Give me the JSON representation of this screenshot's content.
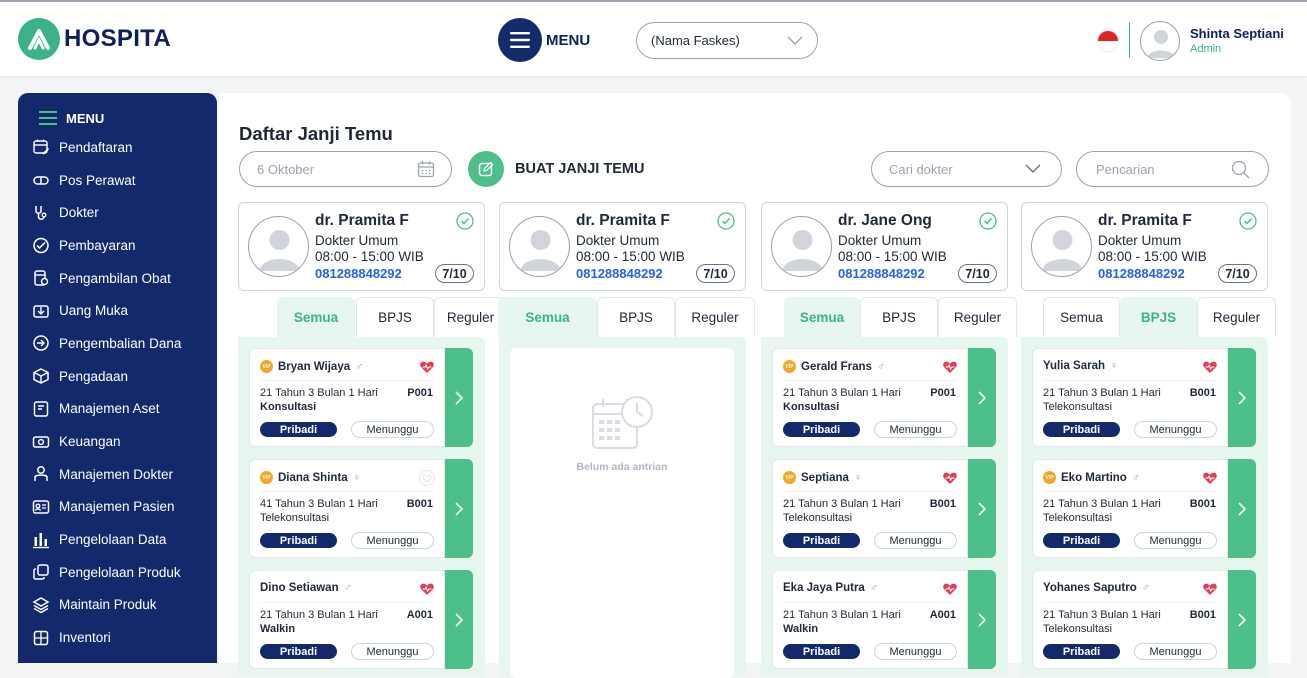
{
  "header": {
    "brand": "HOSPITA",
    "menu_label": "MENU",
    "faskes_value": "(Nama Faskes)",
    "user_name": "Shinta Septiani",
    "user_role": "Admin"
  },
  "sidebar": {
    "title": "MENU",
    "items": [
      {
        "label": "Pendaftaran",
        "icon": "calendar-edit-icon"
      },
      {
        "label": "Pos Perawat",
        "icon": "capsule-icon"
      },
      {
        "label": "Dokter",
        "icon": "stethoscope-icon"
      },
      {
        "label": "Pembayaran",
        "icon": "payment-icon"
      },
      {
        "label": "Pengambilan Obat",
        "icon": "medicine-icon"
      },
      {
        "label": "Uang Muka",
        "icon": "wallet-icon"
      },
      {
        "label": "Pengembalian Dana",
        "icon": "refund-icon"
      },
      {
        "label": "Pengadaan",
        "icon": "box-icon"
      },
      {
        "label": "Manajemen Aset",
        "icon": "asset-icon"
      },
      {
        "label": "Keuangan",
        "icon": "money-icon"
      },
      {
        "label": "Manajemen Dokter",
        "icon": "doctor-icon"
      },
      {
        "label": "Manajemen Pasien",
        "icon": "patient-card-icon"
      },
      {
        "label": "Pengelolaan Data",
        "icon": "bar-chart-icon"
      },
      {
        "label": "Pengelolaan Produk",
        "icon": "products-icon"
      },
      {
        "label": "Maintain Produk",
        "icon": "layers-icon"
      },
      {
        "label": "Inventori",
        "icon": "inventory-icon"
      }
    ]
  },
  "main": {
    "title": "Daftar Janji Temu",
    "date_placeholder": "6 Oktober",
    "create_label": "BUAT  JANJI TEMU",
    "doctor_filter_placeholder": "Cari dokter",
    "search_placeholder": "Pencarian",
    "empty_text": "Belum ada antrian"
  },
  "colors": {
    "navy": "#13296b",
    "green": "#4cbf8a",
    "mint": "#e8f6f0",
    "blue": "#2563eb"
  },
  "columns": [
    {
      "doctor": {
        "name": "dr. Pramita F",
        "specialty": "Dokter Umum",
        "hours": "08:00 - 15:00 WIB",
        "phone": "081288848292",
        "quota": "7/10"
      },
      "tabs": [
        "Semua",
        "BPJS",
        "Reguler"
      ],
      "active_tab": 0,
      "patients": [
        {
          "name": "Bryan Wijaya",
          "vip": true,
          "gender": "♂",
          "heart": "filled",
          "age": "21 Tahun 3 Bulan 1 Hari",
          "code": "P001",
          "type": "Konsultasi",
          "type_bold": true,
          "payment": "Pribadi",
          "status": "Menunggu"
        },
        {
          "name": "Diana Shinta",
          "vip": true,
          "gender": "♀",
          "heart": "outline",
          "age": "41 Tahun 3 Bulan 1 Hari",
          "code": "B001",
          "type": "Telekonsultasi",
          "type_bold": false,
          "payment": "Pribadi",
          "status": "Menunggu"
        },
        {
          "name": "Dino Setiawan",
          "vip": false,
          "gender": "♂",
          "heart": "filled",
          "age": "21 Tahun 3 Bulan 1 Hari",
          "code": "A001",
          "type": "Walkin",
          "type_bold": true,
          "payment": "Pribadi",
          "status": "Menunggu"
        }
      ]
    },
    {
      "doctor": {
        "name": "dr. Pramita F",
        "specialty": "Dokter Umum",
        "hours": "08:00 - 15:00 WIB",
        "phone": "081288848292",
        "quota": "7/10"
      },
      "tabs": [
        "Semua",
        "BPJS",
        "Reguler"
      ],
      "active_tab": 0,
      "patients": []
    },
    {
      "doctor": {
        "name": "dr. Jane Ong",
        "specialty": "Dokter Umum",
        "hours": "08:00 - 15:00 WIB",
        "phone": "081288848292",
        "quota": "7/10"
      },
      "tabs": [
        "Semua",
        "BPJS",
        "Reguler"
      ],
      "active_tab": 0,
      "patients": [
        {
          "name": "Gerald Frans",
          "vip": true,
          "gender": "♂",
          "heart": "filled",
          "age": "21 Tahun 3 Bulan 1 Hari",
          "code": "P001",
          "type": "Konsultasi",
          "type_bold": true,
          "payment": "Pribadi",
          "status": "Menunggu"
        },
        {
          "name": "Septiana",
          "vip": true,
          "gender": "♀",
          "heart": "filled",
          "age": "21 Tahun 3 Bulan 1 Hari",
          "code": "B001",
          "type": "Telekonsultasi",
          "type_bold": false,
          "payment": "Pribadi",
          "status": "Menunggu"
        },
        {
          "name": "Eka Jaya Putra",
          "vip": false,
          "gender": "♂",
          "heart": "filled",
          "age": "21 Tahun 3 Bulan 1 Hari",
          "code": "A001",
          "type": "Walkin",
          "type_bold": true,
          "payment": "Pribadi",
          "status": "Menunggu"
        }
      ]
    },
    {
      "doctor": {
        "name": "dr. Pramita F",
        "specialty": "Dokter Umum",
        "hours": "08:00 - 15:00 WIB",
        "phone": "081288848292",
        "quota": "7/10"
      },
      "tabs": [
        "Semua",
        "BPJS",
        "Reguler"
      ],
      "active_tab": 1,
      "patients": [
        {
          "name": "Yulia Sarah",
          "vip": false,
          "gender": "♀",
          "heart": "filled",
          "age": "21 Tahun 3 Bulan 1 Hari",
          "code": "B001",
          "type": "Telekonsultasi",
          "type_bold": false,
          "payment": "Pribadi",
          "status": "Menunggu"
        },
        {
          "name": "Eko Martino",
          "vip": true,
          "gender": "♂",
          "heart": "filled",
          "age": "21 Tahun 3 Bulan 1 Hari",
          "code": "B001",
          "type": "Telekonsultasi",
          "type_bold": false,
          "payment": "Pribadi",
          "status": "Menunggu"
        },
        {
          "name": "Yohanes Saputro",
          "vip": false,
          "gender": "♂",
          "heart": "filled",
          "age": "21 Tahun 3 Bulan 1 Hari",
          "code": "B001",
          "type": "Telekonsultasi",
          "type_bold": false,
          "payment": "Pribadi",
          "status": "Menunggu"
        }
      ]
    }
  ]
}
